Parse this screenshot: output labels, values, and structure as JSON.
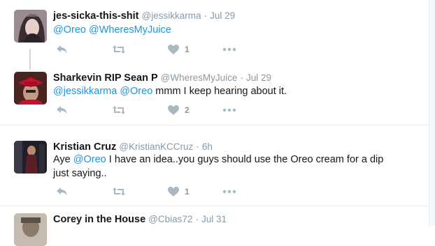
{
  "tweets": [
    {
      "name": "jes-sicka-this-shit",
      "handle": "@jessikkarma",
      "sep": "·",
      "date": "Jul 29",
      "mention1": "@Oreo",
      "mention2": "@WheresMyJuice",
      "like_count": "1",
      "colors": {
        "avatar_bg": "#6b5a5f"
      }
    },
    {
      "name": "Sharkevin RIP Sean P",
      "handle": "@WheresMyJuice",
      "sep": "·",
      "date": "Jul 29",
      "mention1": "@jessikkarma",
      "mention2": "@Oreo",
      "text_after": " mmm I keep hearing about it.",
      "like_count": "2",
      "colors": {
        "avatar_bg": "#3a1a18",
        "cap": "#c8102e"
      }
    },
    {
      "name": "Kristian Cruz",
      "handle": "@KristianKCCruz",
      "sep": "·",
      "date": "6h",
      "text_before": "Aye ",
      "mention1": "@Oreo",
      "text_after": " I have an idea..you guys should use the Oreo cream for a dip just saying..",
      "like_count": "1",
      "colors": {
        "avatar_bg": "#2b2b33"
      }
    },
    {
      "name": "Corey in the House",
      "handle": "@Cbias72",
      "sep": "·",
      "date": "Jul 31",
      "colors": {
        "avatar_bg": "#b0a79a"
      }
    }
  ],
  "colors": {
    "link": "#1b95e0",
    "muted": "#8899a6",
    "icon": "#aab8c2",
    "divider": "#e6ecf0",
    "thread_line": "#ccd6dd"
  }
}
